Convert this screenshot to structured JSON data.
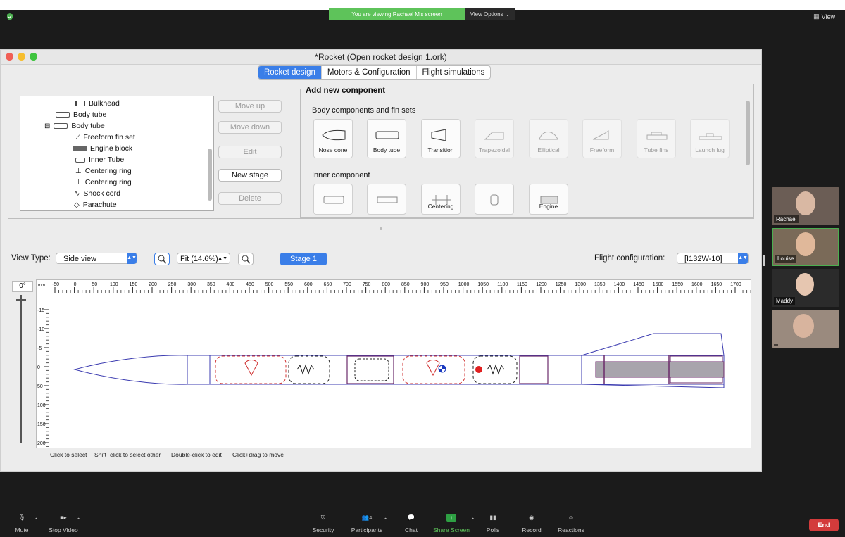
{
  "zoom": {
    "viewing_banner": "You are viewing Rachael M's screen",
    "view_options": "View Options",
    "view_button": "View",
    "participants": [
      {
        "name": "Rachael"
      },
      {
        "name": "Louise"
      },
      {
        "name": "Maddy"
      },
      {
        "name": ""
      }
    ],
    "toolbar": {
      "mute": "Mute",
      "stop_video": "Stop Video",
      "security": "Security",
      "participants": "Participants",
      "participants_count": "4",
      "chat": "Chat",
      "share_screen": "Share Screen",
      "polls": "Polls",
      "record": "Record",
      "reactions": "Reactions",
      "end": "End"
    }
  },
  "app": {
    "title": "*Rocket (Open rocket design 1.ork)",
    "tabs": [
      "Rocket design",
      "Motors & Configuration",
      "Flight simulations"
    ],
    "tree": [
      {
        "label": "Bulkhead"
      },
      {
        "label": "Body tube"
      },
      {
        "label": "Body tube",
        "expander": "⊟"
      },
      {
        "label": "Freeform fin set"
      },
      {
        "label": "Engine block"
      },
      {
        "label": "Inner Tube"
      },
      {
        "label": "Centering ring"
      },
      {
        "label": "Centering ring"
      },
      {
        "label": "Shock cord"
      },
      {
        "label": "Parachute"
      }
    ],
    "buttons": {
      "move_up": "Move up",
      "move_down": "Move down",
      "edit": "Edit",
      "new_stage": "New stage",
      "delete": "Delete"
    },
    "add_component": {
      "title": "Add new component",
      "body_section": "Body components and fin sets",
      "body_items": [
        "Nose cone",
        "Body tube",
        "Transition",
        "Trapezoidal",
        "Elliptical",
        "Freeform",
        "Tube fins",
        "Launch lug"
      ],
      "inner_section": "Inner component",
      "inner_items": [
        "",
        "",
        "Centering",
        "",
        "Engine"
      ]
    },
    "view": {
      "view_type_label": "View Type:",
      "view_type_value": "Side view",
      "zoom_value": "Fit (14.6%)",
      "stage_button": "Stage 1",
      "flight_config_label": "Flight configuration:",
      "flight_config_value": "[I132W-10]",
      "angle": "0°",
      "unit": "mm",
      "hints": [
        "Click to select",
        "Shift+click to select other",
        "Double-click to edit",
        "Click+drag to move"
      ]
    },
    "ruler": {
      "h_ticks": [
        "-50",
        "0",
        "50",
        "100",
        "150",
        "200",
        "250",
        "300",
        "350",
        "400",
        "450",
        "500",
        "550",
        "600",
        "650",
        "700",
        "750",
        "800",
        "850",
        "900",
        "950",
        "1000",
        "1050",
        "1100",
        "1150",
        "1200",
        "1250",
        "1300",
        "1350",
        "1400",
        "1450",
        "1500",
        "1550",
        "1600",
        "1650",
        "1700"
      ],
      "v_ticks": [
        "-15",
        "-10",
        "-5",
        "0",
        "50",
        "100",
        "150",
        "200"
      ]
    },
    "colors": {
      "accent": "#3a7ee8",
      "rocket_outline": "#3b3bb0",
      "parachute": "#d03030"
    }
  }
}
